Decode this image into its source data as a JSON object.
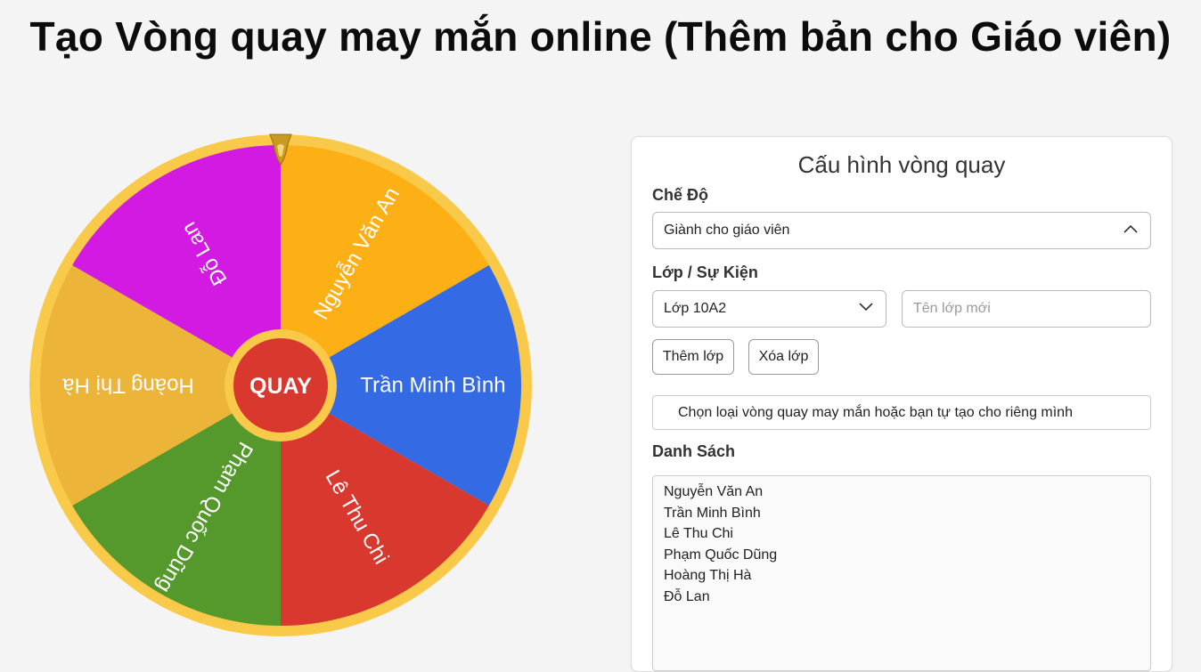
{
  "page": {
    "title": "Tạo Vòng quay may mắn online (Thêm bản cho Giáo viên)"
  },
  "wheel": {
    "spin_label": "QUAY",
    "segments": [
      {
        "label": "Nguyễn Văn An",
        "color": "#FDAF16"
      },
      {
        "label": "Trần Minh Bình",
        "color": "#346BE4"
      },
      {
        "label": "Lê Thu Chi",
        "color": "#D9382F"
      },
      {
        "label": "Phạm Quốc Dũng",
        "color": "#55992D"
      },
      {
        "label": "Hoàng Thị Hà",
        "color": "#EDB43A"
      },
      {
        "label": "Đỗ Lan",
        "color": "#D21AE2"
      }
    ],
    "rim_color": "#F9C94A",
    "hub_color": "#D9382F",
    "pointer": "pointer-icon"
  },
  "config": {
    "title": "Cấu hình vòng quay",
    "mode_label": "Chế Độ",
    "mode_value": "Giành cho giáo viên",
    "class_label": "Lớp / Sự Kiện",
    "class_value": "Lớp 10A2",
    "new_class_placeholder": "Tên lớp mới",
    "add_class_button": "Thêm lớp",
    "delete_class_button": "Xóa lớp",
    "wheel_type_text": "Chọn loại vòng quay may mắn hoặc bạn tự tạo cho riêng mình",
    "list_label": "Danh Sách",
    "list_items": [
      "Nguyễn Văn An",
      "Trần Minh Bình",
      "Lê Thu Chi",
      "Phạm Quốc Dũng",
      "Hoàng Thị Hà",
      "Đỗ Lan"
    ]
  }
}
